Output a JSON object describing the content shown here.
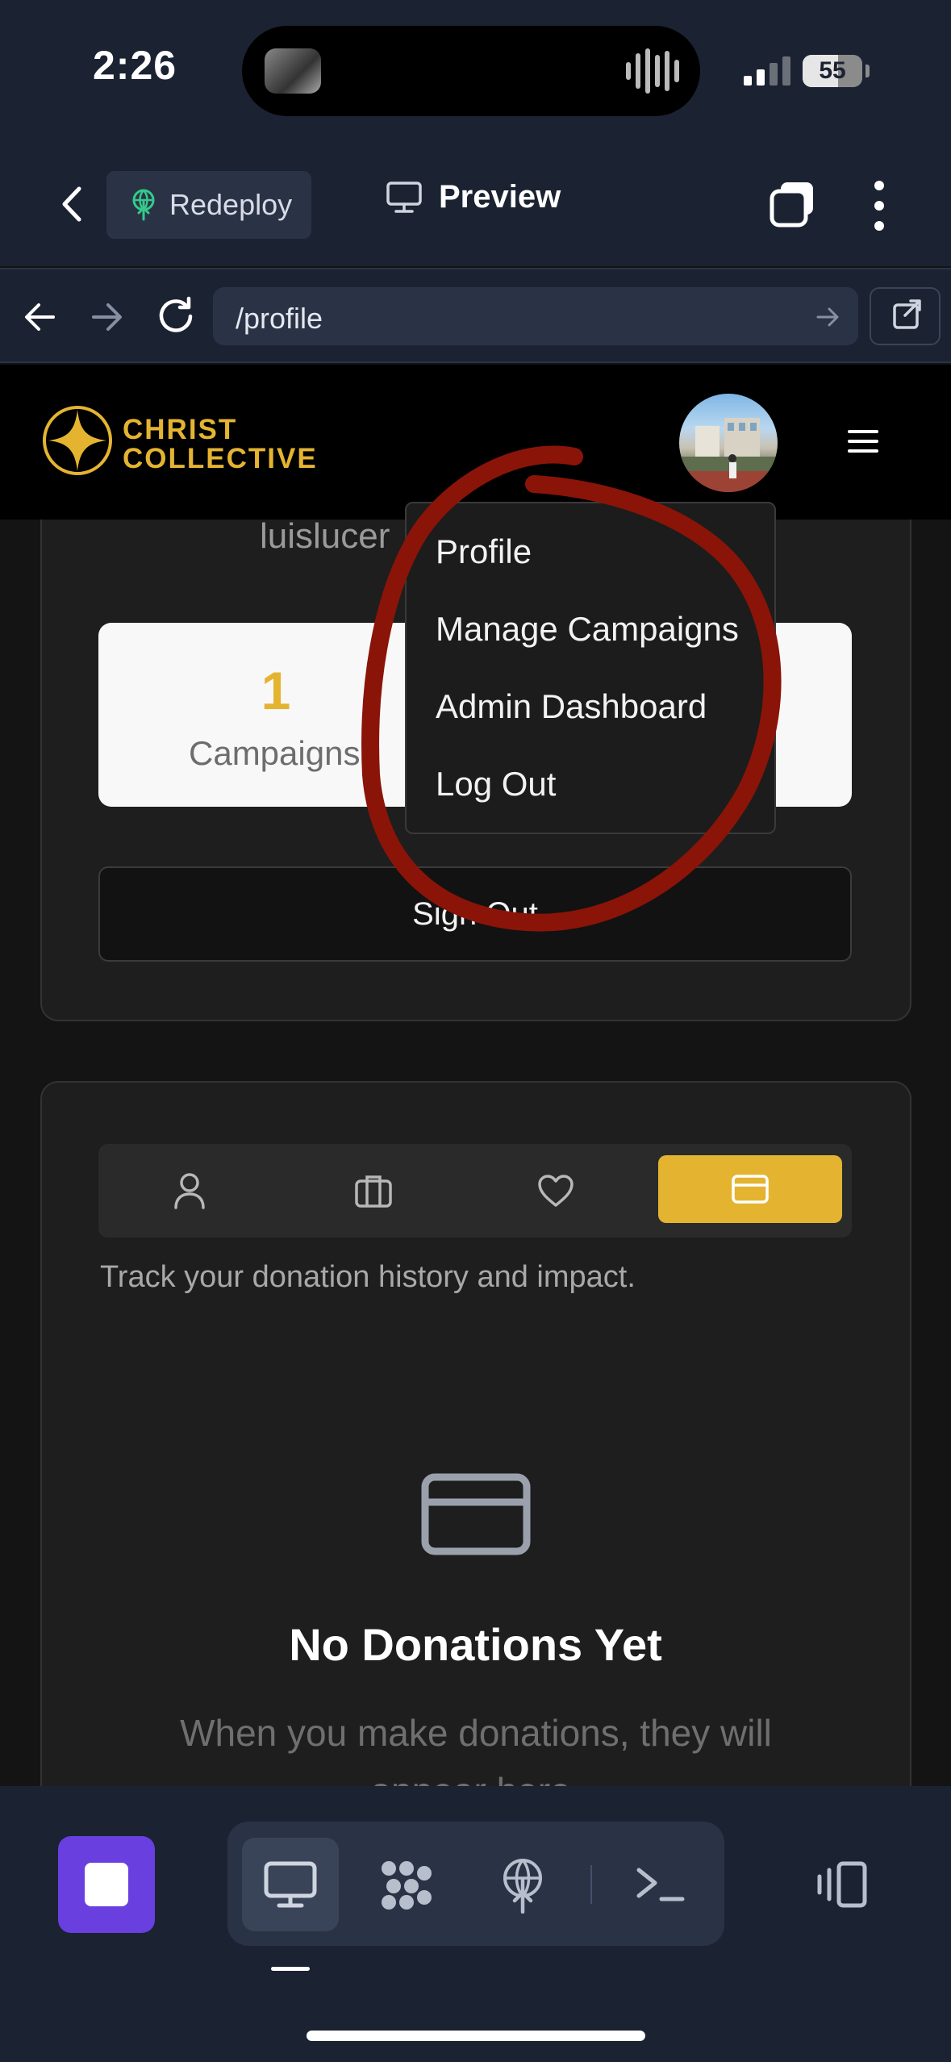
{
  "status_bar": {
    "time": "2:26",
    "battery": "55",
    "signal_bars": 4,
    "signal_active": 2
  },
  "toolbar": {
    "redeploy_label": "Redeploy",
    "preview_label": "Preview"
  },
  "address_bar": {
    "url": "/profile"
  },
  "site": {
    "brand_line1": "CHRIST",
    "brand_line2": "COLLECTIVE",
    "brand_color": "#e4b431"
  },
  "profile": {
    "username": "luislucer",
    "stats": [
      {
        "value": "1",
        "label": "Campaigns"
      }
    ],
    "sign_out_label": "Sign Out"
  },
  "dropdown_menu": {
    "items": [
      {
        "label": "Profile"
      },
      {
        "label": "Manage Campaigns"
      },
      {
        "label": "Admin Dashboard"
      },
      {
        "label": "Log Out"
      }
    ]
  },
  "annotation": {
    "color": "#8a1408",
    "shape": "hand-drawn circle around dropdown menu"
  },
  "dashboard": {
    "tabs": [
      {
        "icon": "user-icon",
        "active": false
      },
      {
        "icon": "briefcase-icon",
        "active": false
      },
      {
        "icon": "heart-icon",
        "active": false
      },
      {
        "icon": "credit-card-icon",
        "active": true
      }
    ],
    "description": "Track your donation history and impact.",
    "empty_title": "No Donations Yet",
    "empty_description": "When you make donations, they will appear here."
  },
  "bottom_toolbar": {
    "accent_color": "#6a3fe0",
    "modes": [
      "monitor-icon",
      "dots-grid-icon",
      "deploy-icon",
      "terminal-icon"
    ],
    "active_mode": "monitor-icon"
  }
}
